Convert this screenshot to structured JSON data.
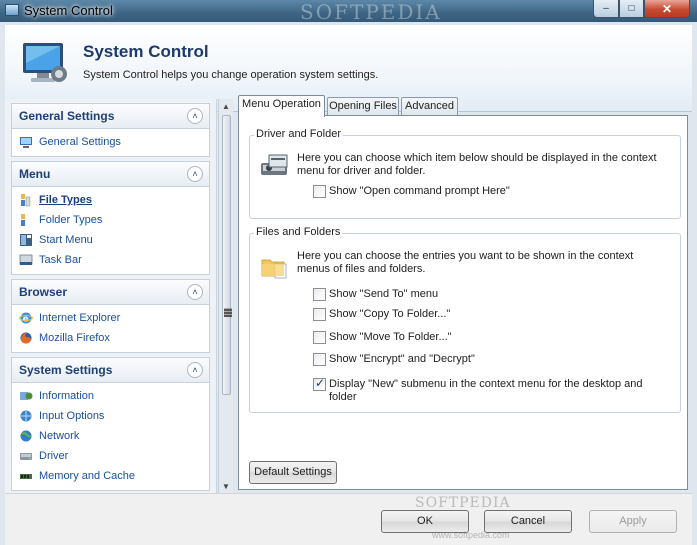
{
  "window": {
    "title": "System Control",
    "watermark": "SOFTPEDIA",
    "watermark_bottom": "SOFTPEDIA",
    "watermark_url": "www.softpedia.com",
    "minimize_glyph": "–",
    "maximize_glyph": "□",
    "close_glyph": "✕"
  },
  "header": {
    "title": "System Control",
    "description": "System Control helps you change operation system settings."
  },
  "sidebar": {
    "collapse_glyph": "˄",
    "groups": [
      {
        "title": "General Settings",
        "items": [
          {
            "label": "General Settings",
            "icon": "monitor-settings-icon"
          }
        ]
      },
      {
        "title": "Menu",
        "items": [
          {
            "label": "File Types",
            "icon": "file-types-icon",
            "active": true
          },
          {
            "label": "Folder Types",
            "icon": "folder-types-icon"
          },
          {
            "label": "Start Menu",
            "icon": "start-menu-icon"
          },
          {
            "label": "Task Bar",
            "icon": "taskbar-icon"
          }
        ]
      },
      {
        "title": "Browser",
        "items": [
          {
            "label": "Internet Explorer",
            "icon": "internet-explorer-icon"
          },
          {
            "label": "Mozilla Firefox",
            "icon": "firefox-icon"
          }
        ]
      },
      {
        "title": "System Settings",
        "items": [
          {
            "label": "Information",
            "icon": "information-icon"
          },
          {
            "label": "Input Options",
            "icon": "input-options-icon"
          },
          {
            "label": "Network",
            "icon": "network-globe-icon"
          },
          {
            "label": "Driver",
            "icon": "driver-icon"
          },
          {
            "label": "Memory and Cache",
            "icon": "memory-icon"
          }
        ]
      }
    ]
  },
  "tabs": [
    {
      "label": "Menu Operation",
      "active": true
    },
    {
      "label": "Opening Files",
      "active": false
    },
    {
      "label": "Advanced",
      "active": false
    }
  ],
  "driver_folder": {
    "legend": "Driver and Folder",
    "description": "Here you can choose which item below should be displayed in the context menu for driver and folder.",
    "options": [
      {
        "label": "Show \"Open command prompt Here\"",
        "checked": false
      }
    ]
  },
  "files_folders": {
    "legend": "Files and Folders",
    "description": "Here you can choose the entries you want to be shown in the context menus of files and folders.",
    "options": [
      {
        "label": "Show \"Send To\" menu",
        "checked": false
      },
      {
        "label": "Show \"Copy To Folder...\"",
        "checked": false
      },
      {
        "label": "Show \"Move To Folder...\"",
        "checked": false
      },
      {
        "label": "Show \"Encrypt\" and \"Decrypt\"",
        "checked": false
      },
      {
        "label": "Display \"New\" submenu in the context menu for the desktop and folder",
        "checked": true
      }
    ]
  },
  "buttons": {
    "default_settings": "Default Settings",
    "ok": "OK",
    "cancel": "Cancel",
    "apply": "Apply"
  }
}
